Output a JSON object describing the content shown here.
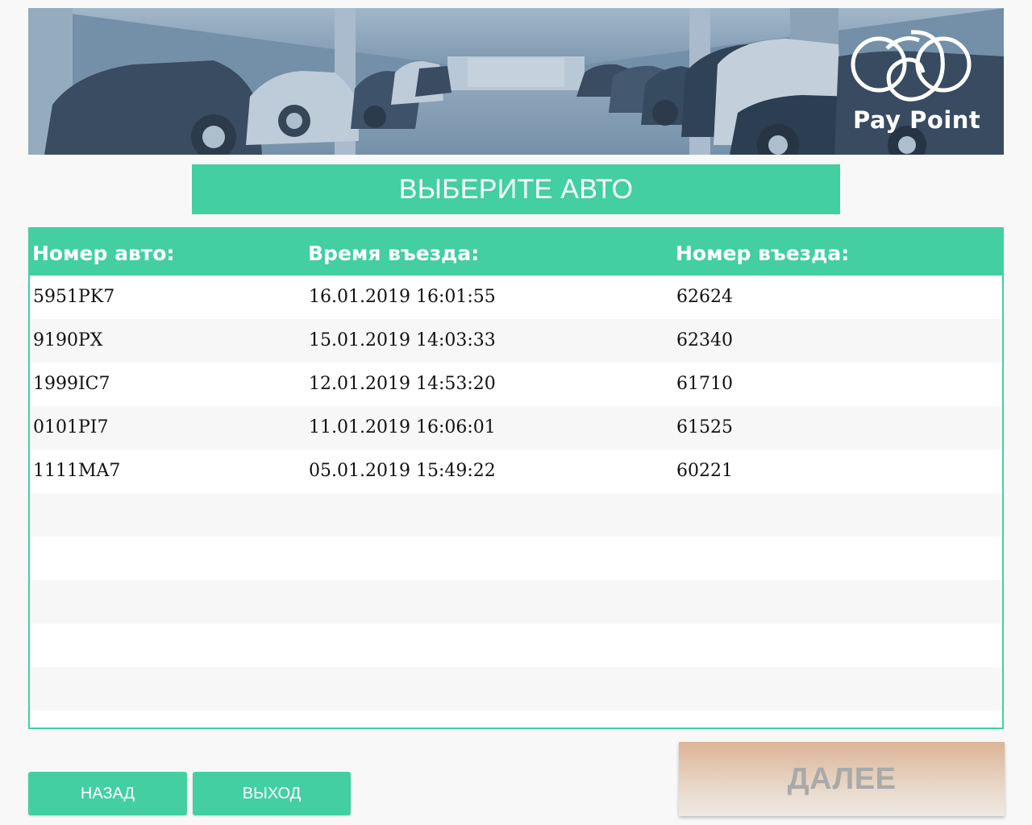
{
  "brand": {
    "logo_text": "Pay Point"
  },
  "title": "ВЫБЕРИТЕ АВТО",
  "table": {
    "columns": [
      "Номер авто:",
      "Время въезда:",
      "Номер въезда:"
    ],
    "rows": [
      [
        "5951PK7",
        "16.01.2019 16:01:55",
        "62624"
      ],
      [
        "9190PX",
        "15.01.2019 14:03:33",
        "62340"
      ],
      [
        "1999IC7",
        "12.01.2019 14:53:20",
        "61710"
      ],
      [
        "0101PI7",
        "11.01.2019 16:06:01",
        "61525"
      ],
      [
        "1111MA7",
        "05.01.2019 15:49:22",
        "60221"
      ],
      [
        "",
        "",
        ""
      ],
      [
        "",
        "",
        ""
      ],
      [
        "",
        "",
        ""
      ],
      [
        "",
        "",
        ""
      ],
      [
        "",
        "",
        ""
      ]
    ]
  },
  "buttons": {
    "back": "НАЗАД",
    "exit": "ВЫХОД",
    "next": "ДАЛЕЕ"
  },
  "colors": {
    "accent": "#43cfa1",
    "next_disabled_text": "#a9a9a9"
  },
  "icons": {
    "logo": "paypoint-logo-icon",
    "banner": "parking-garage-image"
  }
}
